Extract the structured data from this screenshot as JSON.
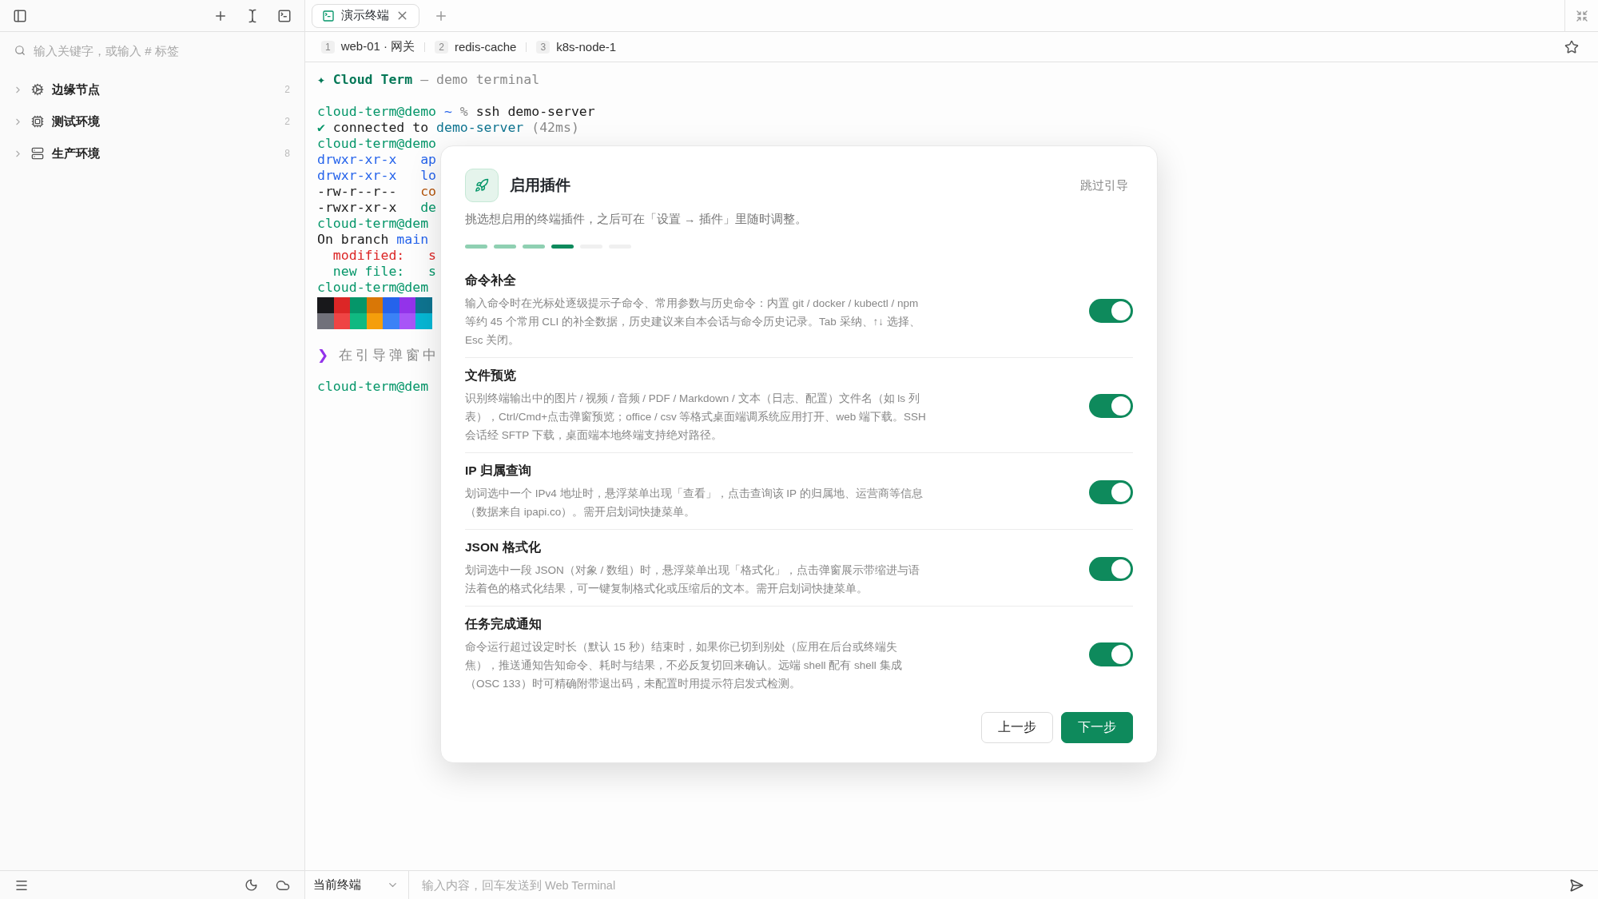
{
  "sidebar": {
    "search": {
      "placeholder": "输入关键字，或输入 # 标签"
    },
    "groups": [
      {
        "kind": "cog",
        "label": "边缘节点",
        "count": "2",
        "expanded": false
      },
      {
        "kind": "chip",
        "label": "测试环境",
        "count": "2",
        "expanded": false
      },
      {
        "kind": "server",
        "label": "生产环境",
        "count": "8",
        "expanded": false
      }
    ]
  },
  "tabs": [
    {
      "label": "演示终端",
      "selected": true
    }
  ],
  "hosts": [
    {
      "index": "1",
      "label": "web-01 · 网关"
    },
    {
      "index": "2",
      "label": "redis-cache"
    },
    {
      "index": "3",
      "label": "k8s-node-1"
    }
  ],
  "terminal": {
    "lines": [
      {
        "kind": "text",
        "segments": [
          {
            "text": "✦ Cloud Term",
            "color": "#047857",
            "bold": true
          },
          {
            "text": " — demo terminal",
            "color": "#8a8a8a"
          }
        ]
      },
      {
        "kind": "blank"
      },
      {
        "kind": "text",
        "segments": [
          {
            "text": "cloud-term@demo",
            "color": "#059669"
          },
          {
            "text": " ~",
            "color": "#2563eb"
          },
          {
            "text": " %",
            "color": "#8a8a8a"
          },
          {
            "text": " ssh demo-server",
            "color": "#1c1c1c"
          }
        ]
      },
      {
        "kind": "text",
        "segments": [
          {
            "text": "✔",
            "color": "#059669"
          },
          {
            "text": " connected to ",
            "color": "#1c1c1c"
          },
          {
            "text": "demo-server",
            "color": "#0e7490"
          },
          {
            "text": " (42ms)",
            "color": "#8a8a8a"
          }
        ]
      },
      {
        "kind": "text",
        "segments": [
          {
            "text": "cloud-term@demo",
            "color": "#059669"
          }
        ]
      },
      {
        "kind": "text",
        "segments": [
          {
            "text": "drwxr-xr-x   ap",
            "color": "#2563eb"
          }
        ]
      },
      {
        "kind": "text",
        "segments": [
          {
            "text": "drwxr-xr-x   lo",
            "color": "#2563eb"
          }
        ]
      },
      {
        "kind": "text",
        "segments": [
          {
            "text": "-rw-r--r--   ",
            "color": "#1c1c1c"
          },
          {
            "text": "co",
            "color": "#b45309"
          }
        ]
      },
      {
        "kind": "text",
        "segments": [
          {
            "text": "-rwxr-xr-x   ",
            "color": "#1c1c1c"
          },
          {
            "text": "de",
            "color": "#059669"
          }
        ]
      },
      {
        "kind": "text",
        "segments": [
          {
            "text": "cloud-term@dem",
            "color": "#059669"
          }
        ]
      },
      {
        "kind": "text",
        "segments": [
          {
            "text": "On branch ",
            "color": "#1c1c1c"
          },
          {
            "text": "main",
            "color": "#2563eb"
          }
        ]
      },
      {
        "kind": "text",
        "segments": [
          {
            "text": "  modified:   s",
            "color": "#dc2626"
          }
        ]
      },
      {
        "kind": "text",
        "segments": [
          {
            "text": "  new file:   s",
            "color": "#059669"
          }
        ]
      },
      {
        "kind": "text",
        "segments": [
          {
            "text": "cloud-term@dem",
            "color": "#059669"
          }
        ]
      },
      {
        "kind": "swatches",
        "rows": [
          [
            {
              "color": "#18181b"
            },
            {
              "color": "#dc2626"
            },
            {
              "color": "#059669"
            },
            {
              "color": "#d97706"
            },
            {
              "color": "#2563eb"
            },
            {
              "color": "#9333ea"
            },
            {
              "color": "#0e7490"
            }
          ],
          [
            {
              "color": "#71717a"
            },
            {
              "color": "#ef4444"
            },
            {
              "color": "#10b981"
            },
            {
              "color": "#f59e0b"
            },
            {
              "color": "#3b82f6"
            },
            {
              "color": "#a855f7"
            },
            {
              "color": "#06b6d4"
            }
          ]
        ]
      },
      {
        "kind": "blank"
      },
      {
        "kind": "hint",
        "segments": [
          {
            "text": "❯",
            "color": "#9333ea"
          },
          {
            "text": " 在引导弹窗中",
            "color": "#8a8a8a"
          }
        ]
      },
      {
        "kind": "blank"
      },
      {
        "kind": "text",
        "segments": [
          {
            "text": "cloud-term@dem",
            "color": "#059669"
          }
        ]
      }
    ]
  },
  "dialog": {
    "title": "启用插件",
    "skip": "跳过引导",
    "subtitle": "挑选想启用的终端插件，之后可在「设置 → 插件」里随时调整。",
    "steps": [
      {
        "done": true,
        "selected": false
      },
      {
        "done": true,
        "selected": false
      },
      {
        "done": true,
        "selected": false
      },
      {
        "done": false,
        "selected": true
      },
      {
        "done": false,
        "selected": false
      },
      {
        "done": false,
        "selected": false
      }
    ],
    "plugins": [
      {
        "name": "命令补全",
        "description": "输入命令时在光标处逐级提示子命令、常用参数与历史命令：内置 git / docker / kubectl / npm 等约 45 个常用 CLI 的补全数据，历史建议来自本会话与命令历史记录。Tab 采纳、↑↓ 选择、Esc 关闭。",
        "on": true
      },
      {
        "name": "文件预览",
        "description": "识别终端输出中的图片 / 视频 / 音频 / PDF / Markdown / 文本（日志、配置）文件名（如 ls 列表），Ctrl/Cmd+点击弹窗预览；office / csv 等格式桌面端调系统应用打开、web 端下载。SSH 会话经 SFTP 下载，桌面端本地终端支持绝对路径。",
        "on": true
      },
      {
        "name": "IP 归属查询",
        "description": "划词选中一个 IPv4 地址时，悬浮菜单出现「查看」，点击查询该 IP 的归属地、运营商等信息（数据来自 ipapi.co）。需开启划词快捷菜单。",
        "on": true
      },
      {
        "name": "JSON 格式化",
        "description": "划词选中一段 JSON（对象 / 数组）时，悬浮菜单出现「格式化」，点击弹窗展示带缩进与语法着色的格式化结果，可一键复制格式化或压缩后的文本。需开启划词快捷菜单。",
        "on": true
      },
      {
        "name": "任务完成通知",
        "description": "命令运行超过设定时长（默认 15 秒）结束时，如果你已切到别处（应用在后台或终端失焦），推送通知告知命令、耗时与结果，不必反复切回来确认。远端 shell 配有 shell 集成（OSC 133）时可精确附带退出码，未配置时用提示符启发式检测。",
        "on": true
      }
    ],
    "buttons": [
      {
        "label": "上一步",
        "kind": "secondary"
      },
      {
        "label": "下一步",
        "kind": "primary"
      }
    ]
  },
  "bottom_bar": {
    "target": "当前终端",
    "input": {
      "placeholder": "输入内容，回车发送到 Web Terminal"
    }
  }
}
